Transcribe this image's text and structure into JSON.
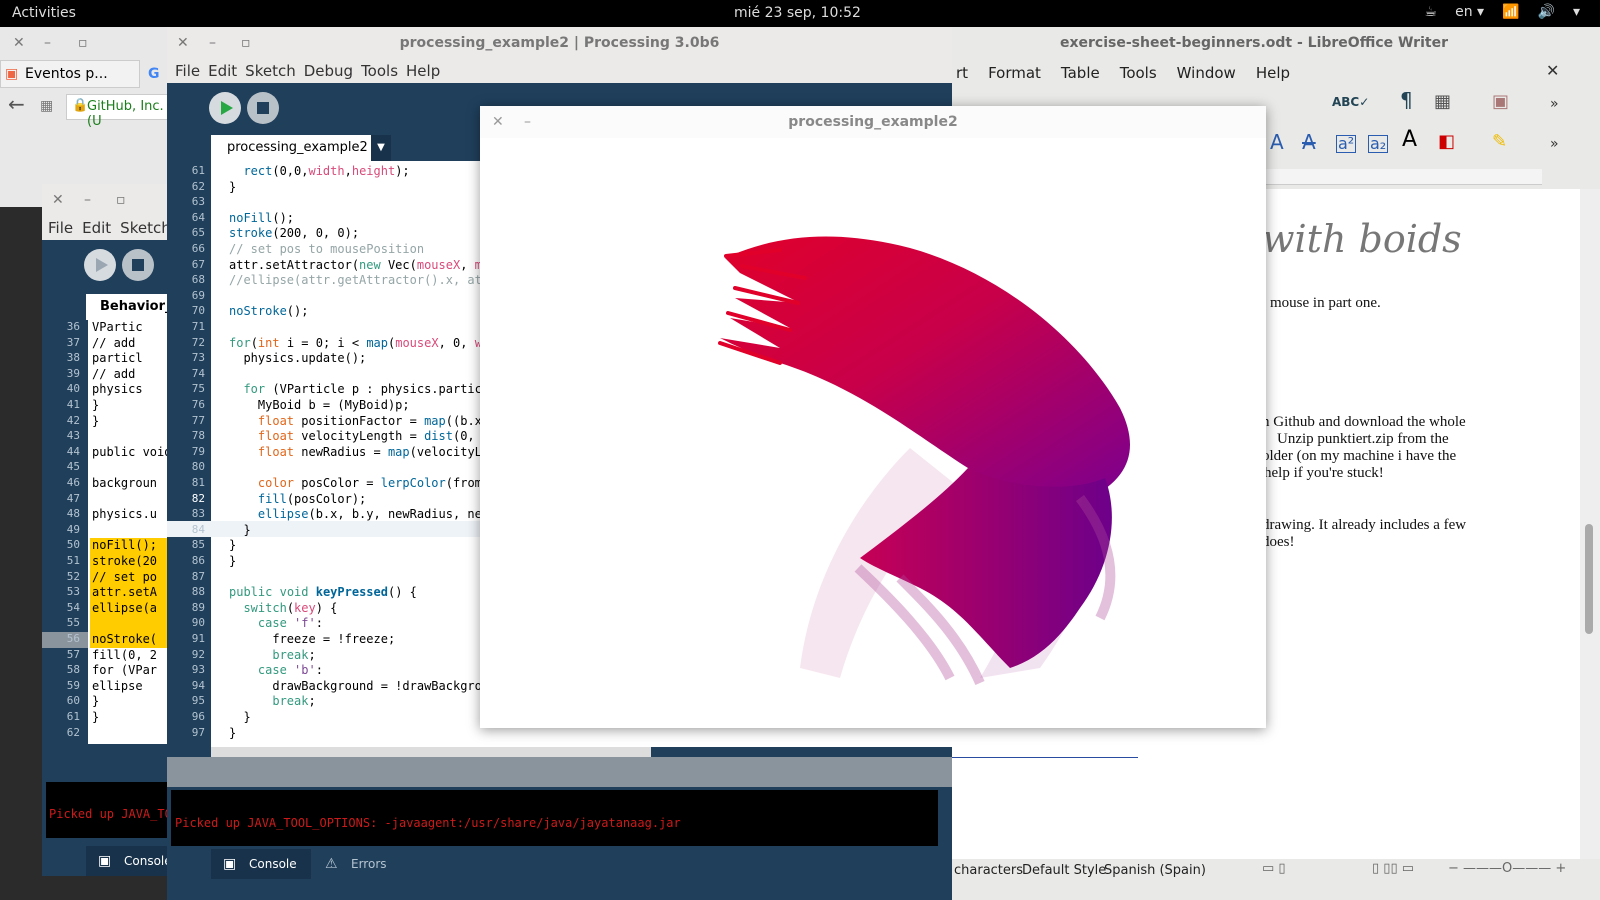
{
  "topbar": {
    "activities": "Activities",
    "clock": "mié 23 sep, 10:52",
    "lang": "en"
  },
  "browser": {
    "tab_title": "Eventos p...",
    "url_text": "GitHub, Inc. (U"
  },
  "libreoffice": {
    "title": "exercise-sheet-beginners.odt - LibreOffice Writer",
    "menu": [
      "rt",
      "Format",
      "Table",
      "Tools",
      "Window",
      "Help"
    ],
    "doc": {
      "heading_fragment": "with boids",
      "p1": "mouse in part one.",
      "p2_l1": "n Github and download the whole",
      "p2_l2": "Unzip  punktiert.zip  from  the",
      "p2_l3": "older  (on my machine i have the",
      "p2_l4": "help if you're stuck!",
      "p3_l1": "drawing. It already includes a few",
      "p3_l2": "does!"
    },
    "status": {
      "characters": "characters",
      "style": "Default Style",
      "language": "Spanish (Spain)"
    }
  },
  "processing_back": {
    "menu": [
      "File",
      "Edit",
      "Sketch"
    ],
    "tab": "Behavior_E",
    "lines": [
      {
        "n": "36",
        "t": "VPartic",
        "hl": false
      },
      {
        "n": "37",
        "t": "// add",
        "hl": false
      },
      {
        "n": "38",
        "t": "particl",
        "hl": false
      },
      {
        "n": "39",
        "t": "// add",
        "hl": false
      },
      {
        "n": "40",
        "t": "physics",
        "hl": false
      },
      {
        "n": "41",
        "t": "}",
        "hl": false
      },
      {
        "n": "42",
        "t": "}",
        "hl": false
      },
      {
        "n": "43",
        "t": "",
        "hl": false
      },
      {
        "n": "44",
        "t": "public void",
        "hl": false
      },
      {
        "n": "45",
        "t": "",
        "hl": false
      },
      {
        "n": "46",
        "t": "backgroun",
        "hl": false
      },
      {
        "n": "47",
        "t": "",
        "hl": false
      },
      {
        "n": "48",
        "t": "physics.u",
        "hl": false
      },
      {
        "n": "49",
        "t": "",
        "hl": false
      },
      {
        "n": "50",
        "t": "noFill();",
        "hl": true
      },
      {
        "n": "51",
        "t": "stroke(20",
        "hl": true
      },
      {
        "n": "52",
        "t": "// set po",
        "hl": true
      },
      {
        "n": "53",
        "t": "attr.setA",
        "hl": true
      },
      {
        "n": "54",
        "t": "ellipse(a",
        "hl": true
      },
      {
        "n": "55",
        "t": "",
        "hl": true
      },
      {
        "n": "56",
        "t": "noStroke(",
        "hl": true
      },
      {
        "n": "57",
        "t": "fill(0, 2",
        "hl": false
      },
      {
        "n": "58",
        "t": "for (VPar",
        "hl": false
      },
      {
        "n": "59",
        "t": "ellipse",
        "hl": false
      },
      {
        "n": "60",
        "t": "}",
        "hl": false
      },
      {
        "n": "61",
        "t": "}",
        "hl": false
      },
      {
        "n": "62",
        "t": "",
        "hl": false
      }
    ],
    "console": "Picked up JAVA_TO",
    "console_tab": "Console"
  },
  "processing_main": {
    "title": "processing_example2 | Processing 3.0b6",
    "menu": [
      "File",
      "Edit",
      "Sketch",
      "Debug",
      "Tools",
      "Help"
    ],
    "tab": "processing_example2",
    "active_line": "82",
    "console": "Picked up JAVA_TOOL_OPTIONS: -javaagent:/usr/share/java/jayatanaag.jar",
    "console_tab": "Console",
    "errors_tab": "Errors"
  },
  "sketch": {
    "title": "processing_example2"
  },
  "colors": {
    "processing_blue": "#1f3f5b",
    "highlight": "#ffcc00",
    "brush_red": "#e0002a",
    "brush_purple": "#7a0090"
  }
}
